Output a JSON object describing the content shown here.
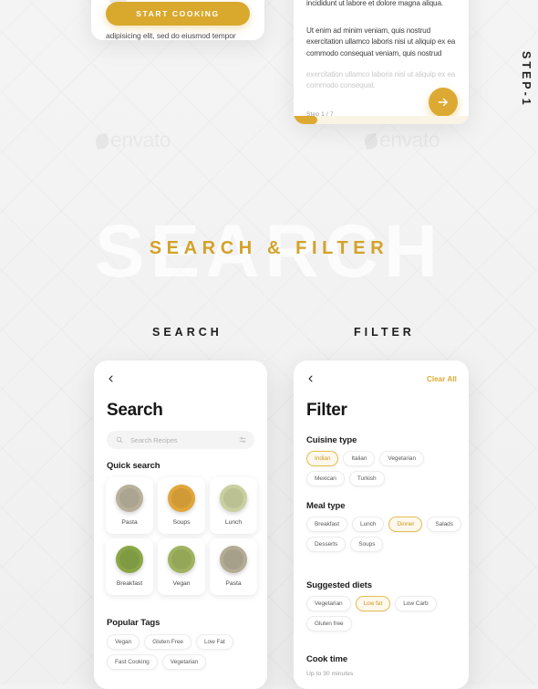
{
  "background": {
    "watermark_text": "envato",
    "hero_watermark": "SEARCH",
    "accent_gold": "#d9a92e",
    "page_bg": "#f2f2f2"
  },
  "hero": {
    "title": "SEARCH & FILTER"
  },
  "step_label": "STEP-1",
  "card_cooking": {
    "button_label": "START COOKING",
    "description": "adipisicing elit, sed do eiusmod tempor"
  },
  "card_steps": {
    "paragraph_1": "incididunt ut labore et dolore magna aliqua.",
    "paragraph_2": "Ut enim ad minim veniam, quis nostrud exercitation ullamco laboris nisi ut aliquip ex ea commodo consequat  veniam, quis nostrud",
    "paragraph_3": "exercitation ullamco laboris nisi ut aliquip ex ea commodo consequat.",
    "step_counter": "Step 1 / 7",
    "next_icon": "arrow-right-icon"
  },
  "captions": {
    "search": "SEARCH",
    "filter": "FILTER"
  },
  "search_screen": {
    "back_icon": "chevron-left-icon",
    "title": "Search",
    "search_placeholder": "Search Recipes",
    "search_icon": "search-icon",
    "tune_icon": "tune-icon",
    "quick_search_heading": "Quick search",
    "quick_items": [
      {
        "label": "Pasta",
        "color": "#b8b09b"
      },
      {
        "label": "Soups",
        "color": "#e0a63a"
      },
      {
        "label": "Lunch",
        "color": "#c9cf9e"
      },
      {
        "label": "Breakfast",
        "color": "#8aa648"
      },
      {
        "label": "Vegan",
        "color": "#9fb25e"
      },
      {
        "label": "Pasta",
        "color": "#b3ab93"
      }
    ],
    "popular_tags_heading": "Popular Tags",
    "popular_tags": [
      {
        "label": "Vegan",
        "selected": false
      },
      {
        "label": "Gluten Free",
        "selected": false
      },
      {
        "label": "Low Fat",
        "selected": false
      },
      {
        "label": "Fast Cooking",
        "selected": false
      },
      {
        "label": "Vegetarian",
        "selected": false
      }
    ]
  },
  "filter_screen": {
    "back_icon": "chevron-left-icon",
    "title": "Filter",
    "clear_all_label": "Clear All",
    "sections": [
      {
        "heading": "Cuisine type",
        "chips": [
          {
            "label": "Indian",
            "selected": true
          },
          {
            "label": "Italian",
            "selected": false
          },
          {
            "label": "Vegetarian",
            "selected": false
          },
          {
            "label": "Mexican",
            "selected": false
          },
          {
            "label": "Turkish",
            "selected": false
          }
        ]
      },
      {
        "heading": "Meal type",
        "chips": [
          {
            "label": "Breakfast",
            "selected": false
          },
          {
            "label": "Lunch",
            "selected": false
          },
          {
            "label": "Dinner",
            "selected": true
          },
          {
            "label": "Salads",
            "selected": false
          },
          {
            "label": "Desserts",
            "selected": false
          },
          {
            "label": "Soups",
            "selected": false
          }
        ]
      },
      {
        "heading": "Suggested diets",
        "chips": [
          {
            "label": "Vegetarian",
            "selected": false
          },
          {
            "label": "Low fat",
            "selected": true
          },
          {
            "label": "Low Carb",
            "selected": false
          },
          {
            "label": "Gluten free",
            "selected": false
          }
        ]
      }
    ],
    "cook_time_heading": "Cook time",
    "cook_time_value": "Up to 30 minutes"
  }
}
